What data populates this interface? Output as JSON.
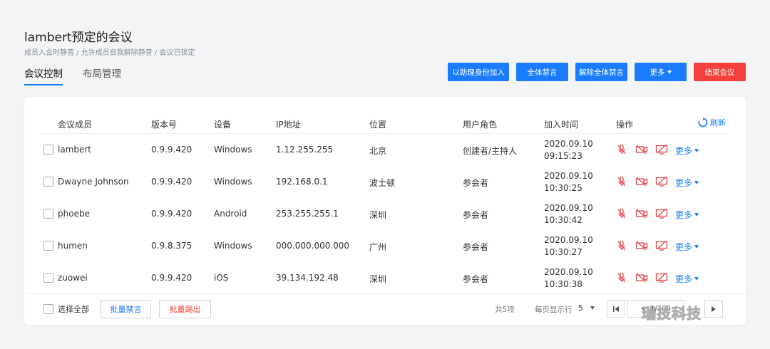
{
  "page": {
    "title": "lambert预定的会议",
    "subtitle": "成员入会时静音 / 允许成员自我解除静音 / 会议已锁定"
  },
  "tabs": [
    "会议控制",
    "布局管理"
  ],
  "actions": {
    "join_as_assistant": "以助理身份加入",
    "mute_all": "全体禁言",
    "unmute_all": "解除全体禁言",
    "more": "更多",
    "end_meeting": "结束会议"
  },
  "table": {
    "headers": [
      "会议成员",
      "版本号",
      "设备",
      "IP地址",
      "位置",
      "用户角色",
      "加入时间",
      "操作"
    ],
    "refresh_label": "刷新",
    "more_label": "更多",
    "rows": [
      {
        "name": "lambert",
        "version": "0.9.9.420",
        "device": "Windows",
        "ip": "1.12.255.255",
        "location": "北京",
        "role": "创建者/主持人",
        "date": "2020.09.10",
        "time": "09:15:23"
      },
      {
        "name": "Dwayne Johnson",
        "version": "0.9.9.420",
        "device": "Windows",
        "ip": "192.168.0.1",
        "location": "波士顿",
        "role": "参会者",
        "date": "2020.09.10",
        "time": "10:30:25"
      },
      {
        "name": "phoebe",
        "version": "0.9.9.420",
        "device": "Android",
        "ip": "253.255.255.1",
        "location": "深圳",
        "role": "参会者",
        "date": "2020.09.10",
        "time": "10:30:42"
      },
      {
        "name": "humen",
        "version": "0.9.8.375",
        "device": "Windows",
        "ip": "000.000.000.000",
        "location": "广州",
        "role": "参会者",
        "date": "2020.09.10",
        "time": "10:30:27"
      },
      {
        "name": "zuowei",
        "version": "0.9.9.420",
        "device": "iOS",
        "ip": "39.134.192.48",
        "location": "深圳",
        "role": "参会者",
        "date": "2020.09.10",
        "time": "10:30:38"
      }
    ]
  },
  "footer": {
    "select_all": "选择全部",
    "batch_mute": "批量禁言",
    "batch_kick": "批量踢出",
    "total": "共5项",
    "per_page_label": "每页显示行",
    "per_page_value": "5",
    "page_indicator": "1/100"
  },
  "watermark": "瑞技科技",
  "colors": {
    "accent": "#1a7bff",
    "danger": "#f5413d",
    "muted_icon": "#e0484b"
  }
}
